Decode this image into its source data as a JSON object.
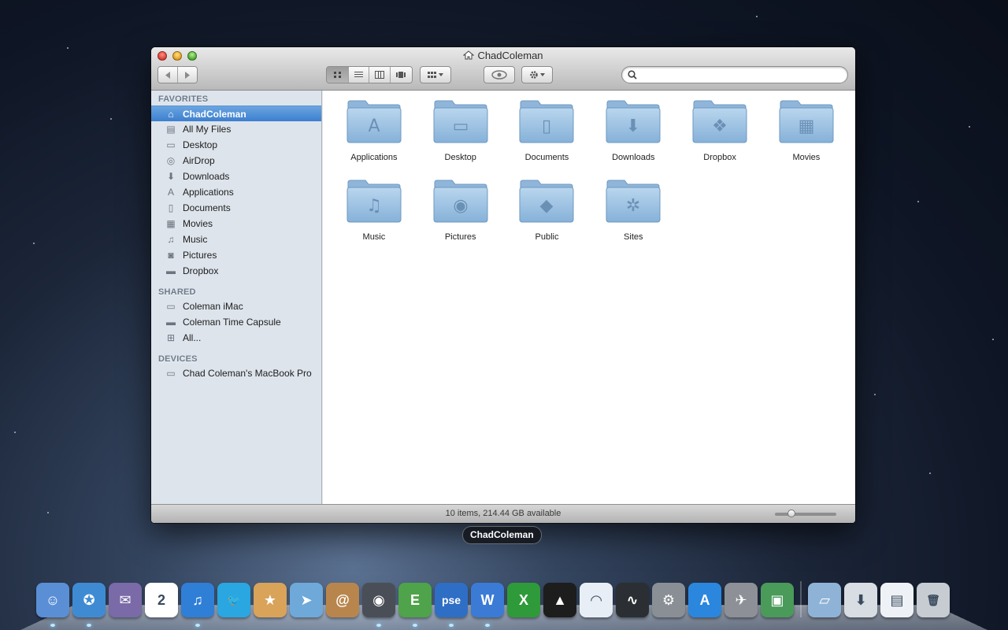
{
  "window": {
    "title": "ChadColeman",
    "search_placeholder": "",
    "status": "10 items, 214.44 GB available"
  },
  "sidebar": {
    "sections": [
      {
        "header": "FAVORITES",
        "items": [
          {
            "label": "ChadColeman",
            "icon": "home-icon",
            "selected": true
          },
          {
            "label": "All My Files",
            "icon": "all-files-icon"
          },
          {
            "label": "Desktop",
            "icon": "desktop-icon"
          },
          {
            "label": "AirDrop",
            "icon": "airdrop-icon"
          },
          {
            "label": "Downloads",
            "icon": "downloads-icon"
          },
          {
            "label": "Applications",
            "icon": "applications-icon"
          },
          {
            "label": "Documents",
            "icon": "documents-icon"
          },
          {
            "label": "Movies",
            "icon": "movies-icon"
          },
          {
            "label": "Music",
            "icon": "music-icon"
          },
          {
            "label": "Pictures",
            "icon": "pictures-icon"
          },
          {
            "label": "Dropbox",
            "icon": "folder-icon"
          }
        ]
      },
      {
        "header": "SHARED",
        "items": [
          {
            "label": "Coleman iMac",
            "icon": "imac-icon"
          },
          {
            "label": "Coleman Time Capsule",
            "icon": "time-capsule-icon"
          },
          {
            "label": "All...",
            "icon": "network-icon"
          }
        ]
      },
      {
        "header": "DEVICES",
        "items": [
          {
            "label": "Chad Coleman's MacBook Pro",
            "icon": "laptop-icon"
          }
        ]
      }
    ]
  },
  "folders": [
    {
      "label": "Applications",
      "glyph": "A"
    },
    {
      "label": "Desktop",
      "glyph": "▭"
    },
    {
      "label": "Documents",
      "glyph": "▯"
    },
    {
      "label": "Downloads",
      "glyph": "⬇"
    },
    {
      "label": "Dropbox",
      "glyph": "❖"
    },
    {
      "label": "Movies",
      "glyph": "▦"
    },
    {
      "label": "Music",
      "glyph": "♫"
    },
    {
      "label": "Pictures",
      "glyph": "◉"
    },
    {
      "label": "Public",
      "glyph": "◆"
    },
    {
      "label": "Sites",
      "glyph": "✲"
    }
  ],
  "tooltip": "ChadColeman",
  "dock": [
    {
      "name": "finder",
      "color": "#5a8fd6",
      "glyph": "☺"
    },
    {
      "name": "safari",
      "color": "#3f8bd3",
      "glyph": "✪"
    },
    {
      "name": "mail-stamp",
      "color": "#7a6aa8",
      "glyph": "✉"
    },
    {
      "name": "calendar",
      "color": "#ffffff",
      "glyph": "2"
    },
    {
      "name": "itunes",
      "color": "#2f7fd6",
      "glyph": "♫"
    },
    {
      "name": "twitter",
      "color": "#2aa6e0",
      "glyph": "🐦"
    },
    {
      "name": "package",
      "color": "#d9a35a",
      "glyph": "★"
    },
    {
      "name": "send",
      "color": "#6fa9d9",
      "glyph": "➤"
    },
    {
      "name": "address-book",
      "color": "#b8864c",
      "glyph": "@"
    },
    {
      "name": "facetime",
      "color": "#4a4f57",
      "glyph": "◉"
    },
    {
      "name": "evernote",
      "color": "#4fa34a",
      "glyph": "E"
    },
    {
      "name": "photoshop-elements",
      "color": "#2f6ec5",
      "glyph": "pse"
    },
    {
      "name": "word",
      "color": "#3b7bd6",
      "glyph": "W"
    },
    {
      "name": "excel",
      "color": "#2f9a3a",
      "glyph": "X"
    },
    {
      "name": "airplay",
      "color": "#1d1d1d",
      "glyph": "▲"
    },
    {
      "name": "wifi",
      "color": "#e8eef5",
      "glyph": "◠"
    },
    {
      "name": "activity-monitor",
      "color": "#2b2f33",
      "glyph": "∿"
    },
    {
      "name": "system-preferences",
      "color": "#8a8f96",
      "glyph": "⚙"
    },
    {
      "name": "app-store",
      "color": "#2b86de",
      "glyph": "A"
    },
    {
      "name": "launchpad",
      "color": "#8d9096",
      "glyph": "✈"
    },
    {
      "name": "preview",
      "color": "#4a9a5a",
      "glyph": "▣"
    },
    {
      "name": "applications-stack",
      "color": "#8fb3d6",
      "glyph": "▱"
    },
    {
      "name": "downloads-stack",
      "color": "#d8dde3",
      "glyph": "⬇"
    },
    {
      "name": "documents-stack",
      "color": "#eef2f6",
      "glyph": "▤"
    },
    {
      "name": "trash",
      "color": "#c7ccd2",
      "glyph": "🗑"
    }
  ]
}
